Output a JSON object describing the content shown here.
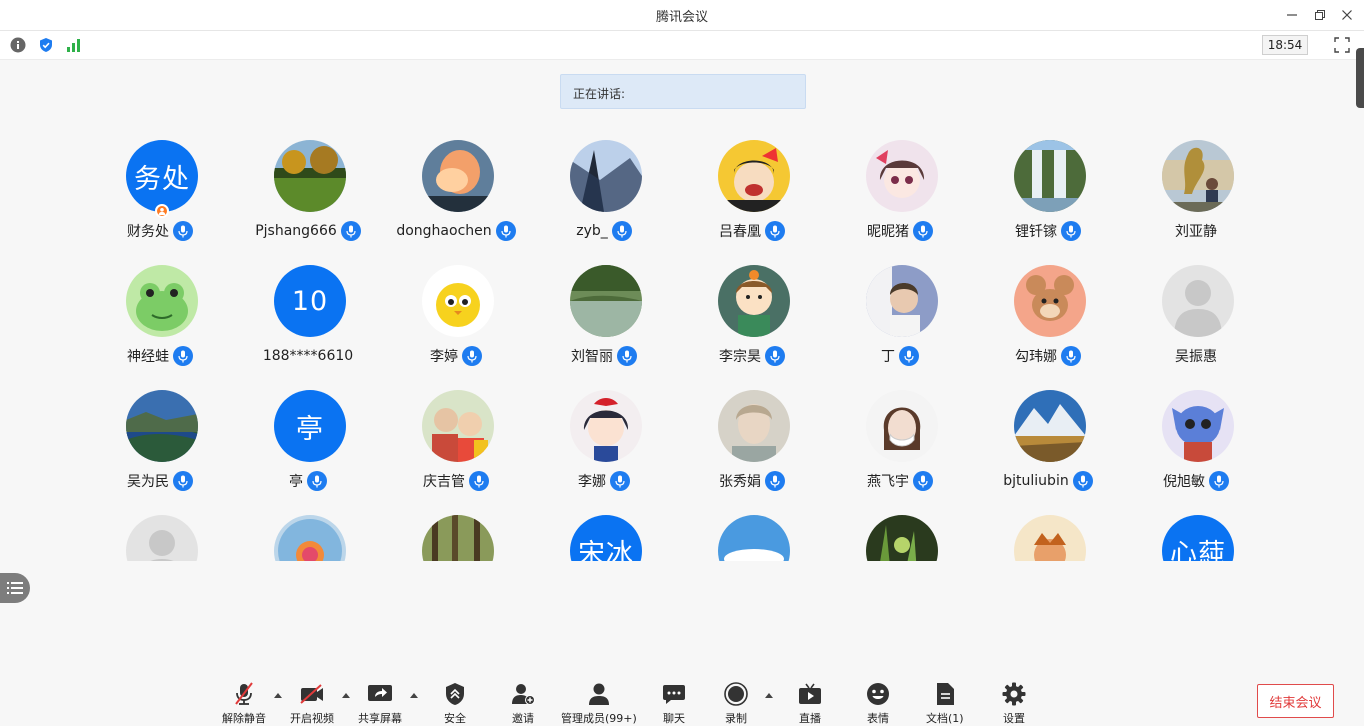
{
  "window": {
    "title": "腾讯会议"
  },
  "infobar": {
    "time": "18:54"
  },
  "speaking": {
    "label": "正在讲话:"
  },
  "colors": {
    "accent": "#0a73f2",
    "mic": "#1e7cf0",
    "host_badge": "#ff7b22",
    "end_meeting": "#e03a3a",
    "speaking_bg": "#dde9f7"
  },
  "participants": [
    {
      "name": "财务处",
      "avatar_text": "务处",
      "avatar": "text",
      "mic": true,
      "host": true
    },
    {
      "name": "Pjshang666",
      "avatar": "photo-field",
      "mic": true
    },
    {
      "name": "donghaochen",
      "avatar": "photo-cloud",
      "mic": true
    },
    {
      "name": "zyb_",
      "avatar": "photo-blue-tree",
      "mic": true
    },
    {
      "name": "吕春凰",
      "avatar": "photo-kiki",
      "mic": true
    },
    {
      "name": "昵昵猪",
      "avatar": "photo-anime-girl",
      "mic": true
    },
    {
      "name": "锂钎镓",
      "avatar": "photo-waterfall",
      "mic": true
    },
    {
      "name": "刘亚静",
      "avatar": "photo-statue",
      "mic": false
    },
    {
      "name": "神经蛙",
      "avatar": "photo-frog",
      "mic": true
    },
    {
      "name": "188****6610",
      "avatar_text": "10",
      "avatar": "text",
      "mic": false
    },
    {
      "name": "李婷",
      "avatar": "photo-chick",
      "mic": true
    },
    {
      "name": "刘智丽",
      "avatar": "photo-lake",
      "mic": true
    },
    {
      "name": "李宗昊",
      "avatar": "photo-kid-cartoon",
      "mic": true
    },
    {
      "name": "丁",
      "avatar": "photo-man",
      "mic": true
    },
    {
      "name": "勾玮娜",
      "avatar": "photo-jerry",
      "mic": true
    },
    {
      "name": "吴振惠",
      "avatar": "default-person",
      "mic": false
    },
    {
      "name": "吴为民",
      "avatar": "photo-bay",
      "mic": true
    },
    {
      "name": "亭",
      "avatar_text": "亭",
      "avatar": "text",
      "mic": true
    },
    {
      "name": "庆吉管",
      "avatar": "photo-family",
      "mic": true
    },
    {
      "name": "李娜",
      "avatar": "photo-snowwhite",
      "mic": true
    },
    {
      "name": "张秀娟",
      "avatar": "photo-portrait",
      "mic": true
    },
    {
      "name": "燕飞宇",
      "avatar": "photo-woman-mask",
      "mic": true
    },
    {
      "name": "bjtuliubin",
      "avatar": "photo-mountain",
      "mic": true
    },
    {
      "name": "倪旭敏",
      "avatar": "photo-stitch",
      "mic": true
    },
    {
      "name": "",
      "avatar": "default-person",
      "mic": false
    },
    {
      "name": "",
      "avatar": "photo-bubble-rose",
      "mic": false
    },
    {
      "name": "",
      "avatar": "photo-forest",
      "mic": false
    },
    {
      "name": "",
      "avatar_text": "宋冰",
      "avatar": "text",
      "mic": false
    },
    {
      "name": "",
      "avatar": "photo-sky",
      "mic": false
    },
    {
      "name": "",
      "avatar": "photo-grass",
      "mic": false
    },
    {
      "name": "",
      "avatar": "photo-cartoon-pink",
      "mic": false
    },
    {
      "name": "",
      "avatar_text": "心蒓",
      "avatar": "text",
      "mic": false
    }
  ],
  "toolbar": {
    "unmute": "解除静音",
    "video": "开启视频",
    "share": "共享屏幕",
    "security": "安全",
    "invite": "邀请",
    "members": "管理成员(99+)",
    "chat": "聊天",
    "record": "录制",
    "live": "直播",
    "reactions": "表情",
    "docs": "文档(1)",
    "settings": "设置",
    "end_meeting": "结束会议"
  }
}
